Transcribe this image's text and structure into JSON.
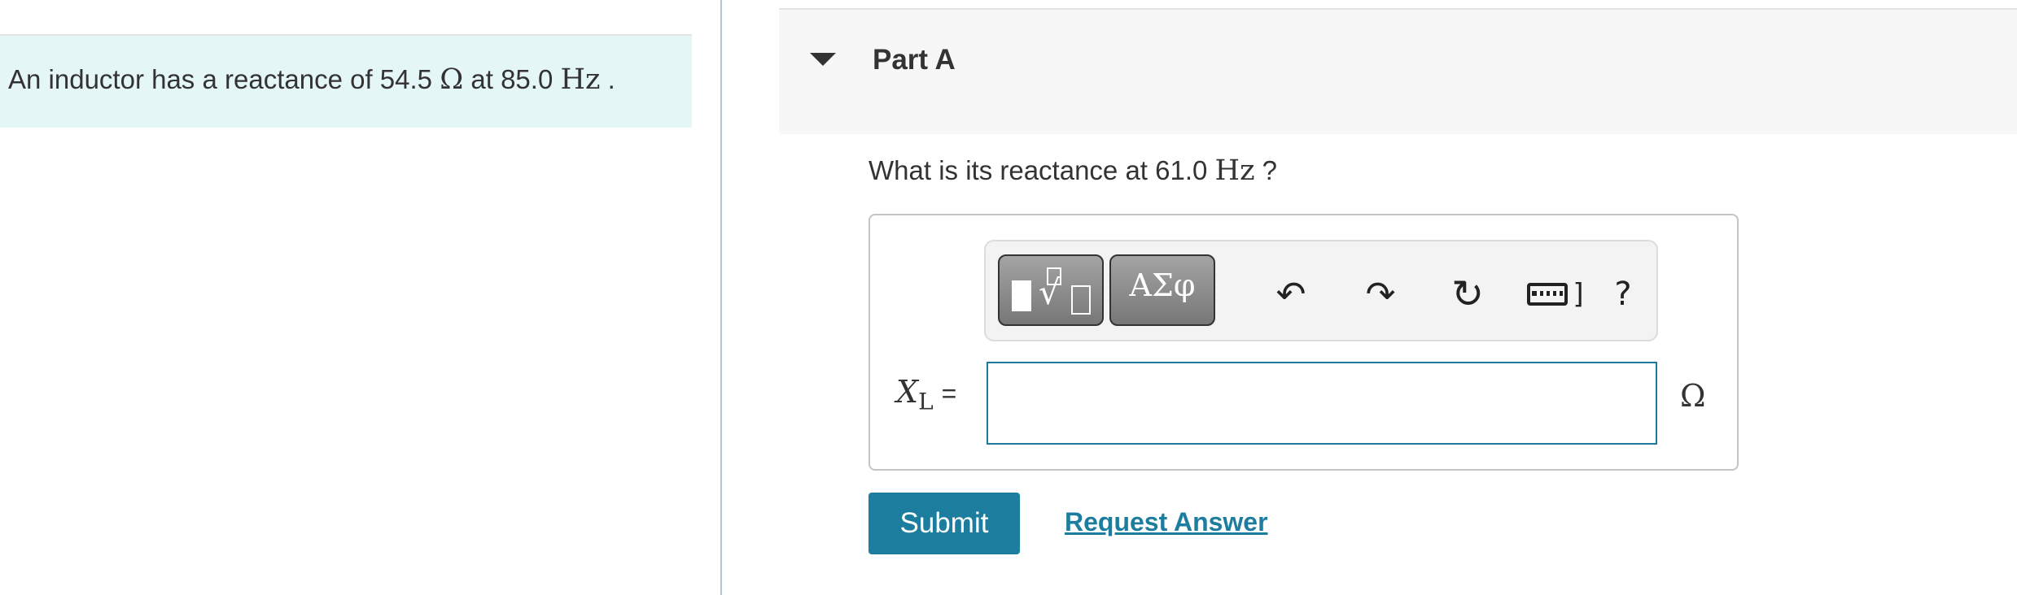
{
  "problem": {
    "text_before": "An inductor has a reactance of 54.5 ",
    "unit_ohm": "Ω",
    "text_mid": " at 85.0 ",
    "unit_hz": "Hz",
    "text_after": " ."
  },
  "part": {
    "title": "Part A"
  },
  "question": {
    "text_before": "What is its reactance at 61.0 ",
    "unit_hz": "Hz",
    "text_after": " ?"
  },
  "toolbar": {
    "templates_button": "templates-icon",
    "greek_label": "ΑΣφ",
    "undo_icon": "↶",
    "redo_icon": "↷",
    "reset_icon": "↻",
    "keyboard_bracket": "]",
    "help_label": "?"
  },
  "answer": {
    "variable": "X",
    "subscript": "L",
    "equals": "=",
    "value": "",
    "unit": "Ω"
  },
  "actions": {
    "submit_label": "Submit",
    "request_answer_label": "Request Answer"
  }
}
